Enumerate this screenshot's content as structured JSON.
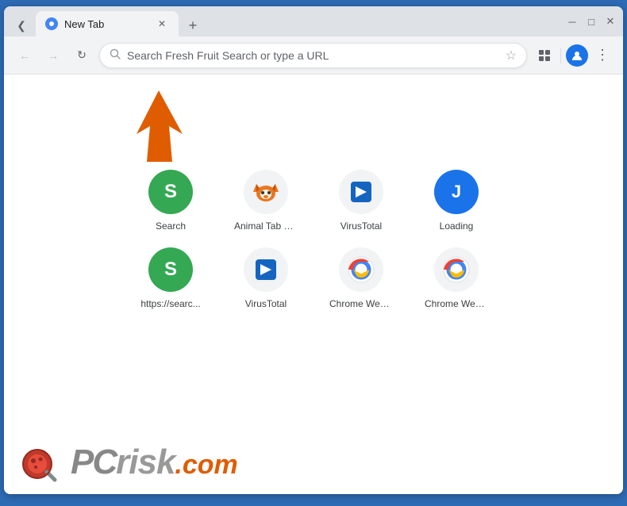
{
  "browser": {
    "tab": {
      "title": "New Tab",
      "favicon_letter": "●"
    },
    "new_tab_btn": "+",
    "window_controls": {
      "minimize": "─",
      "maximize": "□",
      "close": "✕"
    },
    "tab_strip_arrow": "❮"
  },
  "navbar": {
    "back_disabled": true,
    "forward_disabled": true,
    "reload_icon": "↺",
    "omnibox_placeholder": "Search Fresh Fruit Search or type a URL",
    "star_icon": "☆",
    "extension_icon": "⊞",
    "profile_icon": "👤",
    "menu_icon": "⋮"
  },
  "speed_dial": {
    "items": [
      {
        "id": "search",
        "label": "Search",
        "bg_color": "#34a853",
        "letter": "S",
        "row": 1
      },
      {
        "id": "animal-tab",
        "label": "Animal Tab N...",
        "bg_color": "#f1f3f4",
        "is_image": true,
        "row": 1
      },
      {
        "id": "virustotal-1",
        "label": "VirusTotal",
        "bg_color": "#f1f3f4",
        "is_image": true,
        "row": 1
      },
      {
        "id": "loading",
        "label": "Loading",
        "bg_color": "#1a73e8",
        "letter": "J",
        "row": 1
      },
      {
        "id": "https-search",
        "label": "https://searc...",
        "bg_color": "#34a853",
        "letter": "S",
        "row": 2
      },
      {
        "id": "virustotal-2",
        "label": "VirusTotal",
        "bg_color": "#f1f3f4",
        "is_image": true,
        "row": 2
      },
      {
        "id": "chrome-web-1",
        "label": "Chrome Web...",
        "bg_color": "#f1f3f4",
        "is_chrome": true,
        "row": 2
      },
      {
        "id": "chrome-web-2",
        "label": "Chrome Web...",
        "bg_color": "#f1f3f4",
        "is_chrome": true,
        "row": 2
      }
    ]
  },
  "watermark": {
    "site": "PCrisk.com"
  },
  "arrow": {
    "color": "#e05c00"
  }
}
